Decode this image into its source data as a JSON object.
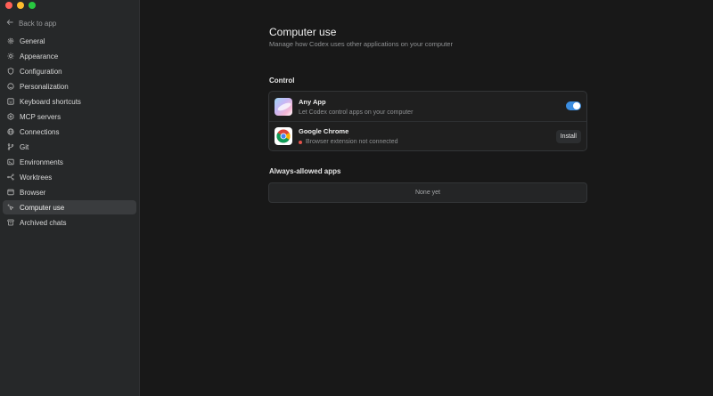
{
  "sidebar": {
    "back_label": "Back to app",
    "items": [
      {
        "label": "General",
        "icon": "gear-icon"
      },
      {
        "label": "Appearance",
        "icon": "sun-icon"
      },
      {
        "label": "Configuration",
        "icon": "shield-icon"
      },
      {
        "label": "Personalization",
        "icon": "smile-icon"
      },
      {
        "label": "Keyboard shortcuts",
        "icon": "keyboard-icon"
      },
      {
        "label": "MCP servers",
        "icon": "hexagon-icon"
      },
      {
        "label": "Connections",
        "icon": "globe-icon"
      },
      {
        "label": "Git",
        "icon": "git-branch-icon"
      },
      {
        "label": "Environments",
        "icon": "terminal-icon"
      },
      {
        "label": "Worktrees",
        "icon": "worktree-icon"
      },
      {
        "label": "Browser",
        "icon": "browser-icon"
      },
      {
        "label": "Computer use",
        "icon": "cursor-sparkle-icon",
        "active": true
      },
      {
        "label": "Archived chats",
        "icon": "archive-icon"
      }
    ]
  },
  "main": {
    "title": "Computer use",
    "subtitle": "Manage how Codex uses other applications on your computer",
    "control": {
      "heading": "Control",
      "any_app": {
        "title": "Any App",
        "description": "Let Codex control apps on your computer",
        "enabled": true
      },
      "chrome": {
        "title": "Google Chrome",
        "status": "Browser extension not connected",
        "button": "Install"
      }
    },
    "always_allowed": {
      "heading": "Always-allowed apps",
      "empty": "None yet"
    }
  },
  "colors": {
    "toggle_on": "#3b8de0",
    "status_error": "#e5534b"
  }
}
